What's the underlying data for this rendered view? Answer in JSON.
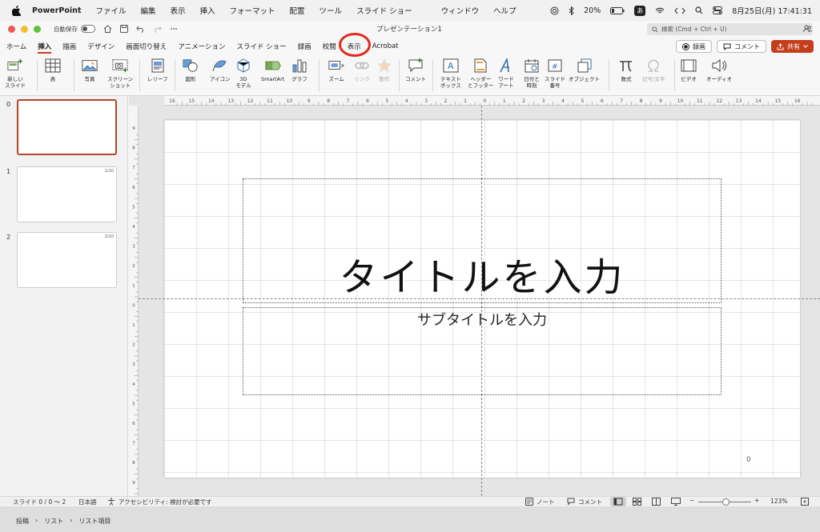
{
  "menubar": {
    "app": "PowerPoint",
    "items": [
      "ファイル",
      "編集",
      "表示",
      "挿入",
      "フォーマット",
      "配置",
      "ツール",
      "スライド ショー",
      "ウィンドウ",
      "ヘルプ"
    ],
    "battery": "20%",
    "ime": "あ",
    "datetime": "8月25日(月)  17:41:31"
  },
  "titlebar": {
    "autosave": "自動保存",
    "doc_title": "プレゼンテーション1",
    "search_placeholder": "検索 (Cmd + Ctrl + U)"
  },
  "tabs": [
    "ホーム",
    "挿入",
    "描画",
    "デザイン",
    "画面切り替え",
    "アニメーション",
    "スライド ショー",
    "録画",
    "校閲",
    "表示",
    "Acrobat"
  ],
  "active_tab": "挿入",
  "highlighted_tab": "表示",
  "tab_actions": {
    "record": "録画",
    "comment": "コメント",
    "share": "共有"
  },
  "ribbon": {
    "new_slide": [
      "新しい",
      "スライド"
    ],
    "table": "表",
    "photo": "写真",
    "screenshot": [
      "スクリーン",
      "ショット"
    ],
    "leaflet": "レリーフ",
    "shapes": "図形",
    "icons": "アイコン",
    "model3d": [
      "3D",
      "モデル"
    ],
    "smartart": "SmartArt",
    "graph": "グラフ",
    "zoom": "ズーム",
    "link": "リンク",
    "action": "動作",
    "comment": "コメント",
    "textbox": [
      "テキスト",
      "ボックス"
    ],
    "header_footer": [
      "ヘッダー",
      "とフッター"
    ],
    "wordart": [
      "ワード",
      "アート"
    ],
    "datetime": [
      "日付と",
      "時刻"
    ],
    "slide_number": [
      "スライド",
      "番号"
    ],
    "object": "オブジェクト",
    "equation": "数式",
    "symbol": "記号/文字",
    "video": "ビデオ",
    "audio": "オーディオ"
  },
  "thumbnails": [
    {
      "num": "0",
      "page": ""
    },
    {
      "num": "1",
      "page": "1/10"
    },
    {
      "num": "2",
      "page": "2/10"
    }
  ],
  "slide": {
    "title": "タイトルを入力",
    "subtitle": "サブタイトルを入力",
    "number": "0"
  },
  "ruler_labels": [
    "16",
    "15",
    "14",
    "13",
    "12",
    "11",
    "10",
    "9",
    "8",
    "7",
    "6",
    "5",
    "4",
    "3",
    "2",
    "1",
    "0",
    "1",
    "2",
    "3",
    "4",
    "5",
    "6",
    "7",
    "8",
    "9",
    "10",
    "11",
    "12",
    "13",
    "14",
    "15",
    "16"
  ],
  "vruler_labels": [
    "9",
    "8",
    "7",
    "6",
    "5",
    "4",
    "3",
    "2",
    "1",
    "0",
    "1",
    "2",
    "3",
    "4",
    "5",
    "6",
    "7",
    "8",
    "9"
  ],
  "status": {
    "slide": "スライド 0 / 0 〜 2",
    "language": "日本語",
    "accessibility": "アクセシビリティ: 検討が必要です",
    "notes": "ノート",
    "comments": "コメント",
    "zoom": "123%"
  },
  "breadcrumb": [
    "投稿",
    "リスト",
    "リスト項目"
  ]
}
